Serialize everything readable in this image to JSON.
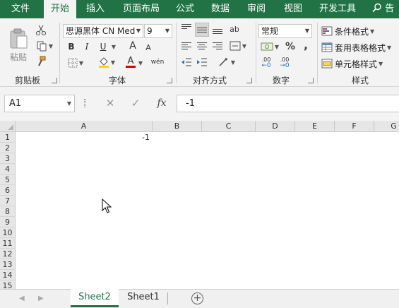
{
  "menu_tabs": [
    "文件",
    "开始",
    "插入",
    "页面布局",
    "公式",
    "数据",
    "审阅",
    "视图",
    "开发工具"
  ],
  "active_tab": "开始",
  "search_text": "告诉",
  "ribbon": {
    "clipboard": {
      "paste_label": "粘贴",
      "group_label": "剪贴板"
    },
    "font": {
      "font_name": "思源黑体 CN Med",
      "font_size": "9",
      "bold": "B",
      "italic": "I",
      "underline": "U",
      "grow": "A",
      "shrink": "A",
      "font_color_glyph": "A",
      "phonetic": "wén",
      "group_label": "字体"
    },
    "alignment": {
      "group_label": "对齐方式",
      "wrap_glyph": "ab"
    },
    "number": {
      "format": "常规",
      "percent": "%",
      "comma": ",",
      "inc_decimal": ".00",
      "dec_decimal": ".00",
      "group_label": "数字"
    },
    "styles": {
      "conditional": "条件格式",
      "table": "套用表格格式",
      "cell": "单元格样式",
      "group_label": "样式"
    }
  },
  "formula_bar": {
    "name_box": "A1",
    "cancel": "✕",
    "enter": "✓",
    "fx": "fx",
    "value": "-1"
  },
  "columns": [
    "A",
    "B",
    "C",
    "D",
    "E",
    "F",
    "G"
  ],
  "rows": [
    "1",
    "2",
    "3",
    "4",
    "5",
    "6",
    "7",
    "8",
    "9",
    "10",
    "11",
    "12",
    "13",
    "14",
    "15"
  ],
  "cells": {
    "A1": "-1"
  },
  "sheets": [
    "Sheet2",
    "Sheet1"
  ],
  "active_sheet": "Sheet2",
  "add_sheet_glyph": "+",
  "colors": {
    "accent": "#217346",
    "ribbon_bg": "#f3f3f3",
    "header_bg": "#e6e6e6"
  }
}
